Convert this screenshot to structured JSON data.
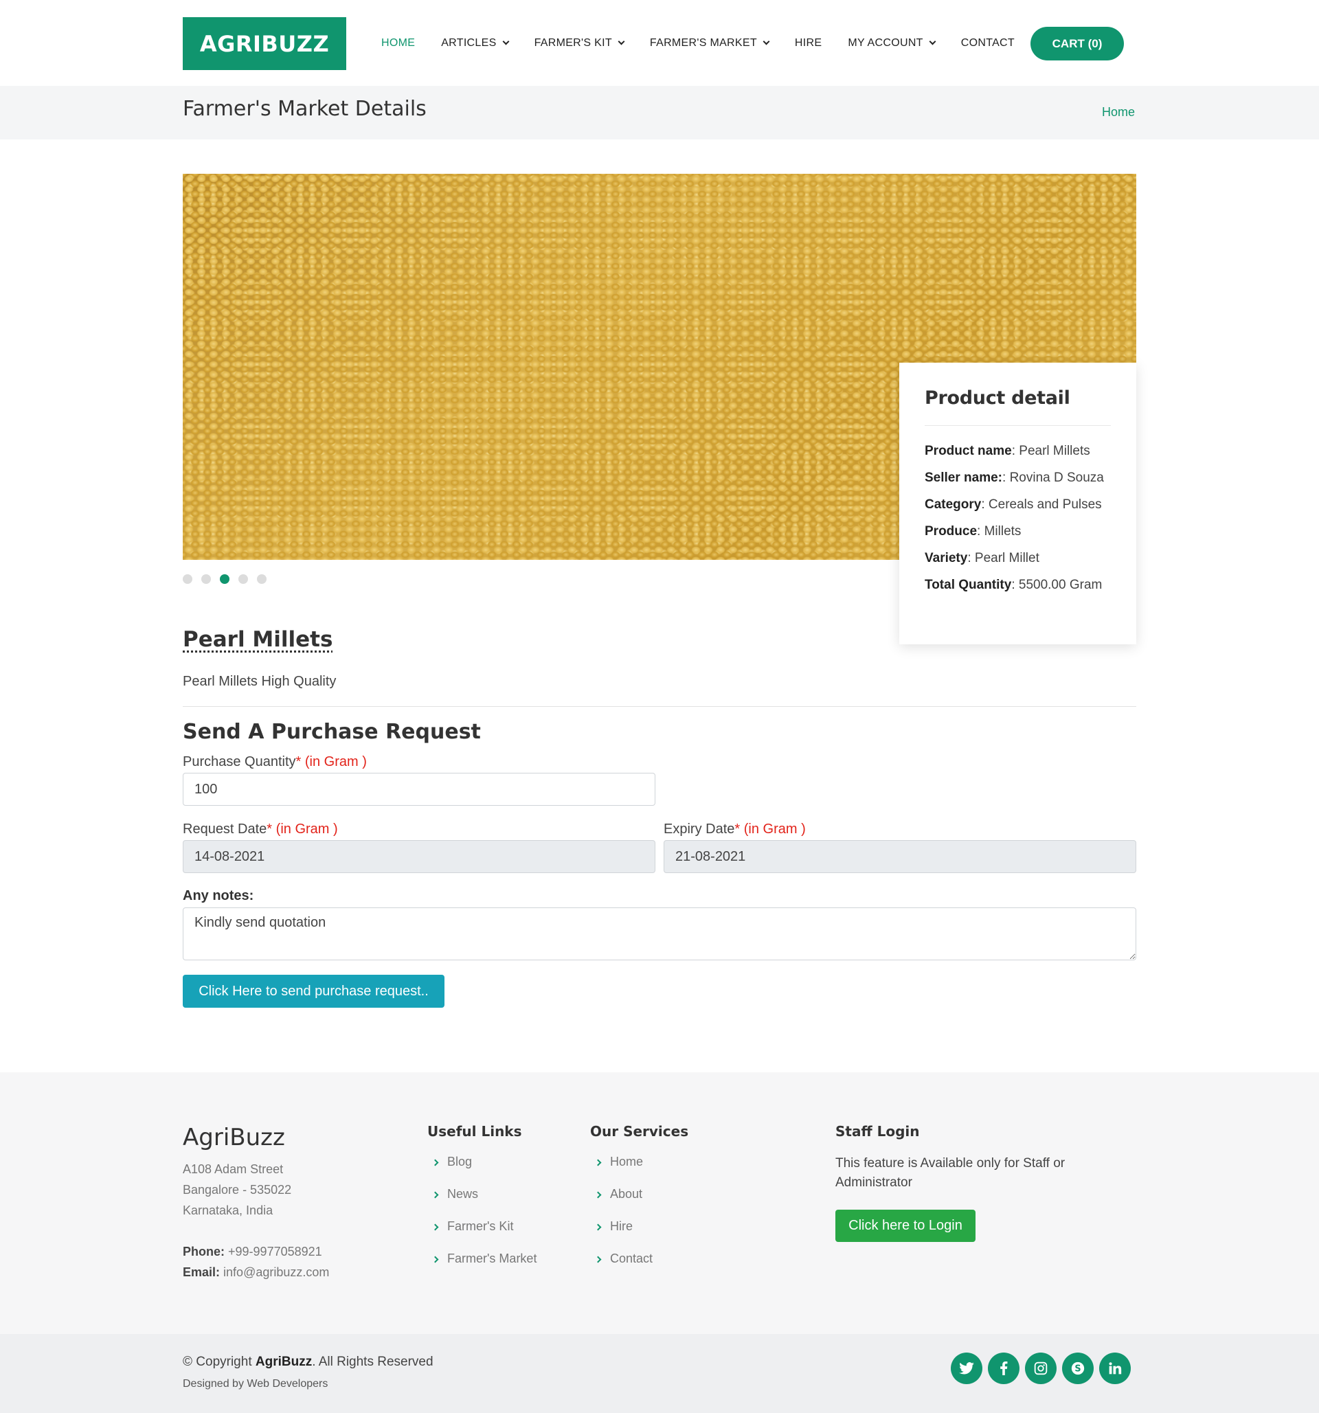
{
  "header": {
    "logo": "AGRIBUZZ",
    "nav": [
      {
        "label": "HOME"
      },
      {
        "label": "ARTICLES"
      },
      {
        "label": "FARMER'S KIT"
      },
      {
        "label": "FARMER'S MARKET"
      },
      {
        "label": "HIRE"
      },
      {
        "label": "MY ACCOUNT"
      },
      {
        "label": "CONTACT"
      }
    ],
    "cart": "CART (0)"
  },
  "titlebar": {
    "title": "Farmer's Market Details",
    "breadcrumb": "Home"
  },
  "carousel": {
    "dots": 5,
    "active_index": 2
  },
  "product_detail": {
    "heading": "Product detail",
    "rows": [
      {
        "label": "Product name",
        "sep": ": ",
        "value": "Pearl Millets"
      },
      {
        "label": "Seller name:",
        "sep": ": ",
        "value": "Rovina D Souza"
      },
      {
        "label": "Category",
        "sep": ": ",
        "value": "Cereals and Pulses"
      },
      {
        "label": "Produce",
        "sep": ": ",
        "value": "Millets"
      },
      {
        "label": "Variety",
        "sep": ": ",
        "value": "Pearl Millet"
      },
      {
        "label": "Total Quantity",
        "sep": ": ",
        "value": "5500.00 Gram"
      }
    ]
  },
  "product": {
    "name": "Pearl Millets",
    "description": "Pearl Millets High Quality"
  },
  "form": {
    "title": "Send A Purchase Request",
    "quantity_label": "Purchase Quantity",
    "quantity_unit": "(in Gram )",
    "quantity_value": "100",
    "request_date_label": "Request Date",
    "request_date_unit": "(in Gram )",
    "request_date_value": "14-08-2021",
    "expiry_date_label": "Expiry Date",
    "expiry_date_unit": "(in Gram )",
    "expiry_date_value": "21-08-2021",
    "notes_label": "Any notes:",
    "notes_value": "Kindly send quotation",
    "required_mark": "*",
    "submit": "Click Here to send purchase request.."
  },
  "footer": {
    "brand": "AgriBuzz",
    "address": [
      "A108 Adam Street",
      "Bangalore - 535022",
      "Karnataka, India"
    ],
    "phone_label": "Phone:",
    "phone": "+99-9977058921",
    "email_label": "Email:",
    "email": "info@agribuzz.com",
    "useful_links_title": "Useful Links",
    "useful_links": [
      "Blog",
      "News",
      "Farmer's Kit",
      "Farmer's Market"
    ],
    "services_title": "Our Services",
    "services": [
      "Home",
      "About",
      "Hire",
      "Contact"
    ],
    "staff_title": "Staff Login",
    "staff_text": "This feature is Available only for Staff or Administrator",
    "login_button": "Click here to Login"
  },
  "bottom": {
    "copyright_prefix": "© Copyright ",
    "copyright_brand": "AgriBuzz",
    "copyright_suffix": ". All Rights Reserved",
    "designed_by": "Designed by Web Developers",
    "social": [
      "twitter-icon",
      "facebook-icon",
      "instagram-icon",
      "skype-icon",
      "linkedin-icon"
    ]
  },
  "colors": {
    "brand": "#10956e",
    "info_button": "#17a2b8",
    "login_button": "#28a745",
    "required": "#e2231a"
  }
}
